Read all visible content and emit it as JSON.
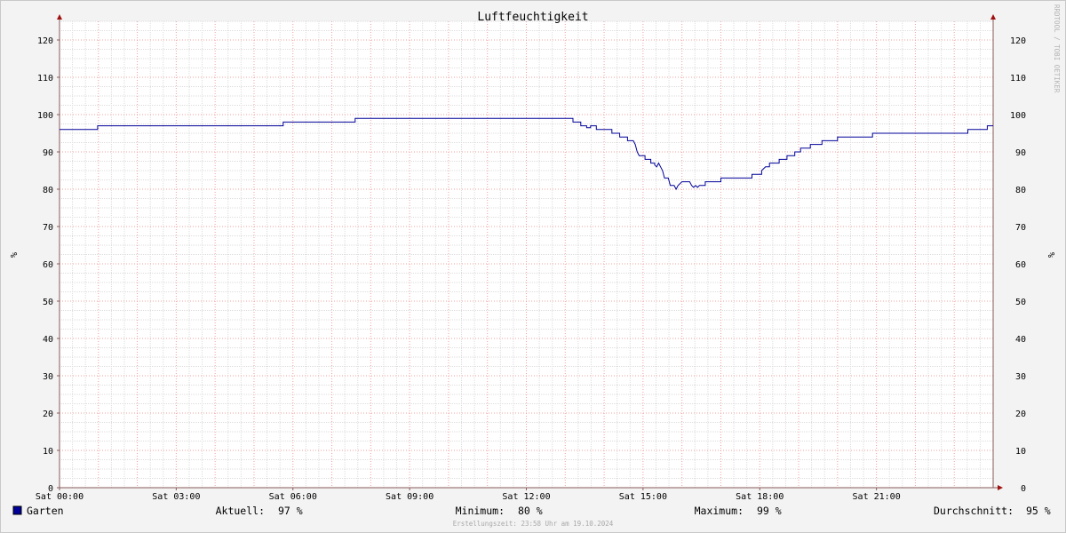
{
  "chart_data": {
    "type": "line",
    "title": "Luftfeuchtigkeit",
    "ylabel": "%",
    "ylim": [
      0,
      125
    ],
    "yticks": [
      0,
      10,
      20,
      30,
      40,
      50,
      60,
      70,
      80,
      90,
      100,
      110,
      120
    ],
    "xlim": [
      0,
      24
    ],
    "xticks": [
      {
        "hour": 0,
        "label": "Sat 00:00"
      },
      {
        "hour": 3,
        "label": "Sat 03:00"
      },
      {
        "hour": 6,
        "label": "Sat 06:00"
      },
      {
        "hour": 9,
        "label": "Sat 09:00"
      },
      {
        "hour": 12,
        "label": "Sat 12:00"
      },
      {
        "hour": 15,
        "label": "Sat 15:00"
      },
      {
        "hour": 18,
        "label": "Sat 18:00"
      },
      {
        "hour": 21,
        "label": "Sat 21:00"
      }
    ],
    "grid": true,
    "legend_position": "bottom",
    "series": [
      {
        "name": "Garten",
        "color": "#000099",
        "points": [
          [
            0.0,
            96
          ],
          [
            0.98,
            96
          ],
          [
            0.98,
            97
          ],
          [
            5.75,
            97
          ],
          [
            5.75,
            98
          ],
          [
            7.6,
            98
          ],
          [
            7.6,
            99
          ],
          [
            13.2,
            99
          ],
          [
            13.2,
            98
          ],
          [
            13.4,
            98
          ],
          [
            13.4,
            97
          ],
          [
            13.55,
            97
          ],
          [
            13.55,
            96.5
          ],
          [
            13.65,
            96.5
          ],
          [
            13.65,
            97
          ],
          [
            13.8,
            97
          ],
          [
            13.8,
            96
          ],
          [
            14.2,
            96
          ],
          [
            14.2,
            95
          ],
          [
            14.4,
            95
          ],
          [
            14.4,
            94
          ],
          [
            14.6,
            94
          ],
          [
            14.6,
            93
          ],
          [
            14.75,
            93
          ],
          [
            14.8,
            92
          ],
          [
            14.85,
            90
          ],
          [
            14.9,
            89
          ],
          [
            15.05,
            89
          ],
          [
            15.05,
            88
          ],
          [
            15.2,
            88
          ],
          [
            15.2,
            87
          ],
          [
            15.3,
            87
          ],
          [
            15.3,
            86.5
          ],
          [
            15.35,
            86
          ],
          [
            15.4,
            87
          ],
          [
            15.45,
            86
          ],
          [
            15.5,
            85
          ],
          [
            15.55,
            83
          ],
          [
            15.65,
            83
          ],
          [
            15.7,
            81
          ],
          [
            15.8,
            81
          ],
          [
            15.85,
            80
          ],
          [
            15.9,
            81
          ],
          [
            16.0,
            82
          ],
          [
            16.2,
            82
          ],
          [
            16.25,
            81
          ],
          [
            16.3,
            80.5
          ],
          [
            16.35,
            81
          ],
          [
            16.4,
            80.5
          ],
          [
            16.45,
            81
          ],
          [
            16.6,
            81
          ],
          [
            16.6,
            82
          ],
          [
            17.0,
            82
          ],
          [
            17.0,
            83
          ],
          [
            17.8,
            83
          ],
          [
            17.8,
            84
          ],
          [
            18.05,
            84
          ],
          [
            18.05,
            85
          ],
          [
            18.15,
            86
          ],
          [
            18.25,
            86
          ],
          [
            18.25,
            87
          ],
          [
            18.5,
            87
          ],
          [
            18.5,
            88
          ],
          [
            18.7,
            88
          ],
          [
            18.7,
            89
          ],
          [
            18.9,
            89
          ],
          [
            18.9,
            90
          ],
          [
            19.05,
            90
          ],
          [
            19.05,
            91
          ],
          [
            19.3,
            91
          ],
          [
            19.3,
            92
          ],
          [
            19.6,
            92
          ],
          [
            19.6,
            93
          ],
          [
            20.0,
            93
          ],
          [
            20.0,
            94
          ],
          [
            20.9,
            94
          ],
          [
            20.9,
            95
          ],
          [
            23.35,
            95
          ],
          [
            23.35,
            96
          ],
          [
            23.85,
            96
          ],
          [
            23.85,
            97
          ],
          [
            24.0,
            97
          ]
        ]
      }
    ],
    "stats": {
      "current": {
        "label": "Aktuell:",
        "value": "97 %"
      },
      "minimum": {
        "label": "Minimum:",
        "value": "80 %"
      },
      "maximum": {
        "label": "Maximum:",
        "value": "99 %"
      },
      "average": {
        "label": "Durchschnitt:",
        "value": "95 %"
      }
    },
    "footer": "Erstellungszeit: 23:58 Uhr am 19.10.2024",
    "watermark": "RRDTOOL / TOBI OETIKER"
  }
}
